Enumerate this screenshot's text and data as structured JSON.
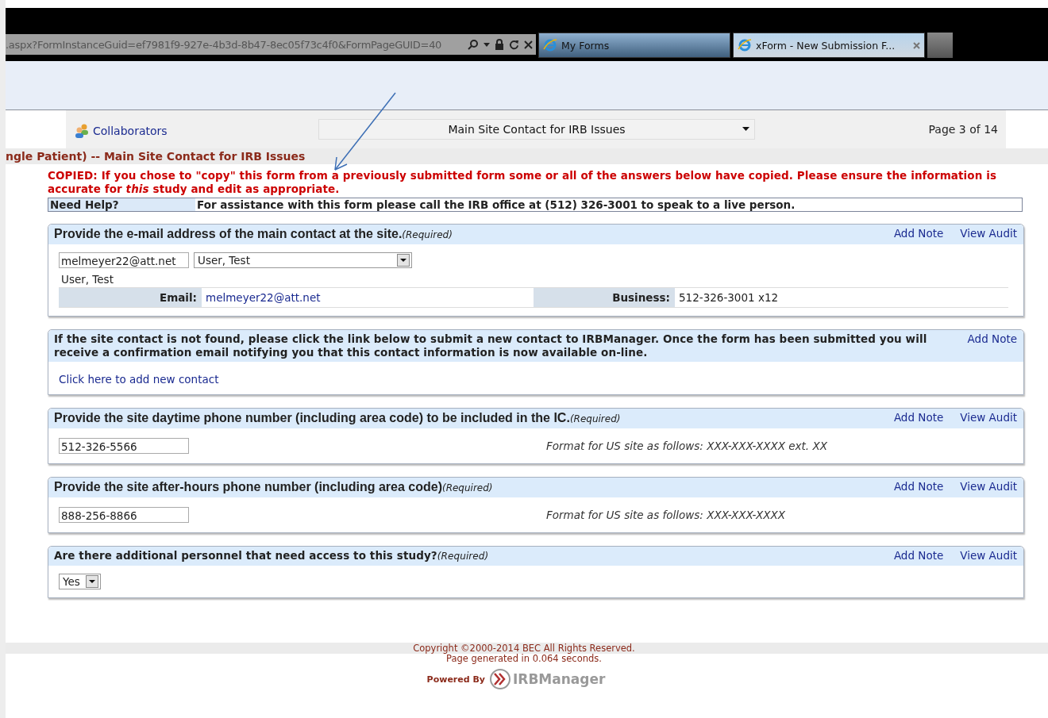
{
  "browser": {
    "address": ".aspx?FormInstanceGuid=ef7981f9-927e-4b3d-8b47-8ec05f73c4f0&FormPageGUID=40",
    "tabs": [
      {
        "title": "My Forms",
        "selected": false
      },
      {
        "title": "xForm - New Submission F...",
        "selected": true
      }
    ]
  },
  "toolbar": {
    "collaborators": "Collaborators",
    "page_select": "Main Site Contact for IRB Issues",
    "page_label": "Page 3 of 14"
  },
  "breadcrumb": "ngle Patient) -- Main Site Contact for IRB Issues",
  "copied_notice": "COPIED: If you chose to \"copy\" this form from a previously submitted form some or all of the answers below have copied. Please ensure the information is accurate for *this* study and edit as appropriate.",
  "help": {
    "label": "Need Help?",
    "text": "For assistance with this form please call the IRB office at (512) 326-3001 to speak to a live person."
  },
  "questions": [
    {
      "kind": "contact",
      "prompt": "Provide the e-mail address of the main contact at the site.",
      "required": "(Required)",
      "links": [
        "Add Note",
        "View Audit"
      ],
      "email_value": "melmeyer22@att.net",
      "contact_select": "User, Test",
      "contact_name": "User, Test",
      "email_label": "Email:",
      "email": "melmeyer22@att.net",
      "business_label": "Business:",
      "business": "512-326-3001 x12"
    },
    {
      "kind": "info",
      "prompt": "If the site contact is not found, please click the link below to submit a new contact to IRBManager. Once the form has been submitted you will receive a confirmation email notifying you that this contact information is now available on-line.",
      "links": [
        "Add Note"
      ],
      "link": "Click here to add new contact"
    },
    {
      "kind": "phone",
      "prompt": "Provide the site daytime phone number (including area code) to be included in the IC.",
      "required": "(Required)",
      "links": [
        "Add Note",
        "View Audit"
      ],
      "value": "512-326-5566",
      "hint": "Format for US site as follows: XXX-XXX-XXXX ext. XX"
    },
    {
      "kind": "phone",
      "prompt": "Provide the site after-hours phone number (including area code)",
      "required": "(Required)",
      "links": [
        "Add Note",
        "View Audit"
      ],
      "value": "888-256-8866",
      "hint": "Format for US site as follows: XXX-XXX-XXXX"
    },
    {
      "kind": "select",
      "prompt": "Are there additional personnel that need access to this study?",
      "required": "(Required)",
      "links": [
        "Add Note",
        "View Audit"
      ],
      "value": "Yes"
    }
  ],
  "footer": {
    "copyright": "Copyright ©2000-2014 BEC All Rights Reserved.",
    "generated": "Page generated in 0.064 seconds.",
    "powered_by": "Powered By",
    "logo": "**IRB**Manager"
  }
}
